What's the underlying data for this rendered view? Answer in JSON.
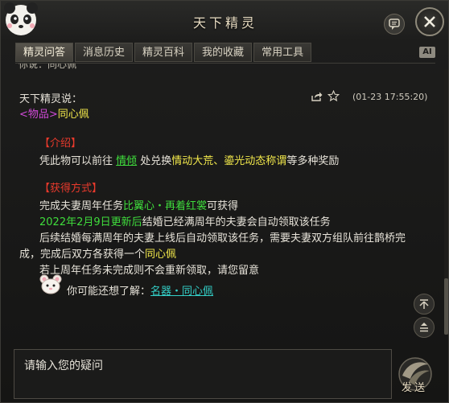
{
  "window": {
    "title": "天下精灵"
  },
  "tabs": [
    {
      "label": "精灵问答",
      "active": true
    },
    {
      "label": "消息历史",
      "active": false
    },
    {
      "label": "精灵百科",
      "active": false
    },
    {
      "label": "我的收藏",
      "active": false
    },
    {
      "label": "常用工具",
      "active": false
    }
  ],
  "ai_badge": "AI",
  "previous_line": "你说：同心佩",
  "message": {
    "sender": "天下精灵说：",
    "timestamp": "(01-23 17:55:20)",
    "item_tag": "<物品>",
    "item_name": "同心佩",
    "intro_heading": "【介绍】",
    "intro": {
      "prefix": "凭此物可以前往 ",
      "npc": "情倾",
      "middle": " 处兑换",
      "rewards": "情动大荒、鎏光动态称谓",
      "suffix": "等多种奖励"
    },
    "obtain_heading": "【获得方式】",
    "obtain_line1": {
      "prefix": "完成夫妻周年任务",
      "task": "比翼心・再着红裳",
      "suffix": "可获得"
    },
    "obtain_line2": {
      "date": "2022年2月9日更新后",
      "rest": "结婚已经满周年的夫妻会自动领取该任务"
    },
    "obtain_line3": "后续结婚每满周年的夫妻上线后自动领取该任务，需要夫妻双方组队前往鹊桥完",
    "obtain_line4": {
      "prefix": "成，完成后双方各获得一个",
      "item": "同心佩"
    },
    "obtain_line5": "若上周年任务未完成则不会重新领取，请您留意",
    "suggest_prefix": "你可能还想了解：",
    "suggest_link": "名器・同心佩"
  },
  "input": {
    "placeholder": "请输入您的疑问"
  },
  "send_label": "发送",
  "icons": {
    "chat": "chat-bubble-icon",
    "close": "close-icon",
    "share": "share-icon",
    "favorite": "star-icon",
    "scroll_top": "scroll-top-icon",
    "scroll_bottom": "scroll-bottom-icon"
  },
  "colors": {
    "item_tag": "#d04ad8",
    "highlight": "#f2e84b",
    "heading": "#ea3a2c",
    "green": "#3fdc3c",
    "link": "#33d0c8"
  }
}
